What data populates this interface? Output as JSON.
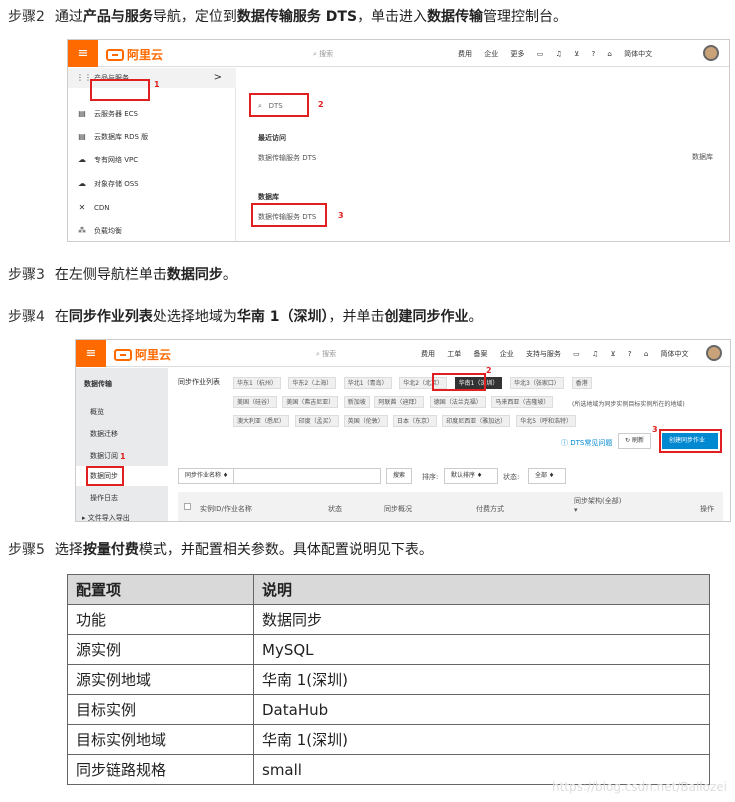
{
  "steps": [
    {
      "label": "步骤2",
      "parts": [
        "通过",
        "产品与服务",
        "导航，定位到",
        "数据传输服务 DTS",
        "，单击进入",
        "数据传输",
        "管理控制台。"
      ]
    },
    {
      "label": "步骤3",
      "parts": [
        "在左侧导航栏单击",
        "数据同步",
        "。"
      ]
    },
    {
      "label": "步骤4",
      "parts": [
        "在",
        "同步作业列表",
        "处选择地域为",
        "华南 1（深圳）",
        "，并单击",
        "创建同步作业",
        "。"
      ]
    },
    {
      "label": "步骤5",
      "parts": [
        "选择",
        "按量付费",
        "模式，并配置相关参数。具体配置说明见下表。"
      ]
    }
  ],
  "shot1": {
    "logo": "阿里云",
    "search_placeholder": "搜索",
    "topnav": [
      "费用",
      "企业",
      "更多"
    ],
    "lang": "简体中文",
    "sidebar": [
      {
        "icon": "grid-icon",
        "glyph": "⋮⋮",
        "label": "产品与服务"
      },
      {
        "icon": "server-icon",
        "glyph": "▤",
        "label": "云服务器 ECS"
      },
      {
        "icon": "database-icon",
        "glyph": "▤",
        "label": "云数据库 RDS 版"
      },
      {
        "icon": "vpc-icon",
        "glyph": "☁",
        "label": "专有网络 VPC"
      },
      {
        "icon": "oss-icon",
        "glyph": "☁",
        "label": "对象存储 OSS"
      },
      {
        "icon": "cdn-icon",
        "glyph": "✕",
        "label": "CDN"
      },
      {
        "icon": "slb-icon",
        "glyph": "⁂",
        "label": "负载均衡"
      }
    ],
    "chevron": ">",
    "search_value": "DTS",
    "recent_title": "最近访问",
    "recent_item": "数据传输服务 DTS",
    "db_title": "数据库",
    "db_item": "数据传输服务 DTS",
    "right_label": "数据库",
    "badges": [
      "1",
      "2",
      "3"
    ]
  },
  "shot2": {
    "logo": "阿里云",
    "search_placeholder": "搜索",
    "topnav": [
      "费用",
      "工单",
      "备案",
      "企业",
      "支持与服务"
    ],
    "lang": "简体中文",
    "sidebar_title": "数据传输",
    "sidebar": [
      "概览",
      "数据迁移",
      "数据订阅",
      "数据同步",
      "操作日志",
      "▸ 文件导入导出"
    ],
    "list_title": "同步作业列表",
    "regions_row1": [
      "华东1（杭州）",
      "华东2（上海）",
      "华北1（青岛）",
      "华北2（北京）",
      "华南1（深圳）",
      "华北3（张家口）",
      "香港"
    ],
    "regions_row2": [
      "美国（硅谷）",
      "美国（弗吉尼亚）",
      "新加坡",
      "阿联酋（迪拜）",
      "德国（法兰克福）",
      "马来西亚（吉隆坡）"
    ],
    "regions_row3": [
      "澳大利亚（悉尼）",
      "印度（孟买）",
      "英国（伦敦）",
      "日本（东京）",
      "印度尼西亚（雅加达）",
      "华北5（呼和浩特）"
    ],
    "region_note": "(所选地域为同步实例目标实例所在的地域)",
    "faq": "DTS常见问题",
    "refresh": "刷新",
    "create": "创建同步作业",
    "filter_select": "同步作业名称 ♦",
    "search_btn": "搜索",
    "sort_label": "排序:",
    "sort_value": "默认排序 ♦",
    "status_label": "状态:",
    "status_value": "全部 ♦",
    "columns": [
      "实例ID/作业名称",
      "状态",
      "同步概况",
      "付费方式",
      "同步架构(全部)",
      "操作"
    ],
    "badges": [
      "1",
      "2",
      "3"
    ]
  },
  "table": {
    "headers": [
      "配置项",
      "说明"
    ],
    "rows": [
      [
        "功能",
        "数据同步"
      ],
      [
        "源实例",
        "MySQL"
      ],
      [
        "源实例地域",
        "华南 1(深圳)"
      ],
      [
        "目标实例",
        "DataHub"
      ],
      [
        "目标实例地域",
        "华南 1(深圳)"
      ],
      [
        "同步链路规格",
        "small"
      ]
    ]
  },
  "watermark": "https://blog.csdn.net/Ballozei"
}
